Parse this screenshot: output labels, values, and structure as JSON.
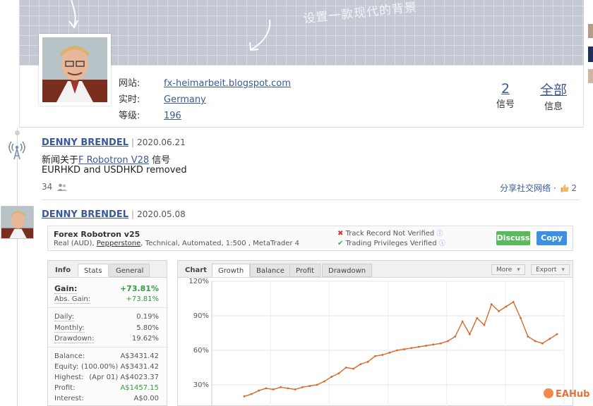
{
  "banner": {
    "hint": "设置一款现代的背景"
  },
  "profile": {
    "fields": [
      {
        "label": "网站:",
        "value": "fx-heimarbeit.blogspot.com"
      },
      {
        "label": "实时:",
        "value": "Germany"
      },
      {
        "label": "等级:",
        "value": "196"
      }
    ],
    "stats": [
      {
        "value": "2",
        "label": "信号"
      },
      {
        "value": "全部",
        "label": "信息"
      }
    ]
  },
  "feed": [
    {
      "author": "DENNY BRENDEL",
      "sep": "|",
      "date": "2020.06.21",
      "text_prefix": "新闻关于",
      "link": "F Robotron V28",
      "text_suffix": " 信号",
      "body": "EURHKD and USDHKD removed",
      "followers": "34",
      "share": "分享社交网络 ·",
      "likes": "2"
    },
    {
      "author": "DENNY BRENDEL",
      "sep": "|",
      "date": "2020.05.08"
    }
  ],
  "system": {
    "name": "Forex Robotron v25",
    "desc_prefix": "Real (AUD), ",
    "broker": "Pepperstone",
    "desc_suffix": ", Technical, Automated, 1:500 , MetaTrader 4",
    "track_record": "Track Record Not Verified",
    "privileges": "Trading Privileges Verified",
    "discuss": "Discuss",
    "copy": "Copy",
    "colors": {
      "discuss": "#5cb85c",
      "copy": "#3d8fe0",
      "gain": "#2e9e3e",
      "line": "#d9692a"
    }
  },
  "info_panel": {
    "tabs": [
      "Info",
      "Stats",
      "General"
    ],
    "gain": {
      "label": "Gain:",
      "value": "+73.81%"
    },
    "abs_gain": {
      "label": "Abs. Gain:",
      "value": "+73.81%"
    },
    "rows_a": [
      {
        "label": "Daily:",
        "value": "0.19%"
      },
      {
        "label": "Monthly:",
        "value": "5.80%"
      },
      {
        "label": "Drawdown:",
        "value": "19.62%"
      }
    ],
    "rows_b": [
      {
        "label": "Balance:",
        "value": "A$3431.42"
      },
      {
        "label": "Equity:",
        "value": "(100.00%) A$3431.42"
      },
      {
        "label": "Highest:",
        "value": "(Apr 01) A$4023.37"
      },
      {
        "label": "Profit:",
        "value": "A$1457.15"
      },
      {
        "label": "Interest:",
        "value": "A$0.00"
      }
    ]
  },
  "chart_panel": {
    "tabs": [
      "Chart",
      "Growth",
      "Balance",
      "Profit",
      "Drawdown"
    ],
    "more": "More",
    "export": "Export"
  },
  "brand": "EAHub",
  "chart_data": {
    "type": "line",
    "title": "",
    "xlabel": "",
    "ylabel": "",
    "ylim": [
      20,
      120
    ],
    "yticks": [
      "120%",
      "90%",
      "60%",
      "30%"
    ],
    "ytick_values": [
      120,
      90,
      60,
      30
    ],
    "grid": true,
    "series": [
      {
        "values": [
          20,
          22,
          25,
          27,
          26,
          28,
          27,
          26,
          28,
          29,
          30,
          33,
          37,
          40,
          45,
          44,
          48,
          50,
          55,
          56,
          58,
          60,
          61,
          62,
          63,
          64,
          65,
          66,
          68,
          72,
          85,
          74,
          88,
          82,
          100,
          94,
          98,
          102,
          88,
          72,
          68,
          66,
          70,
          74
        ]
      }
    ]
  }
}
